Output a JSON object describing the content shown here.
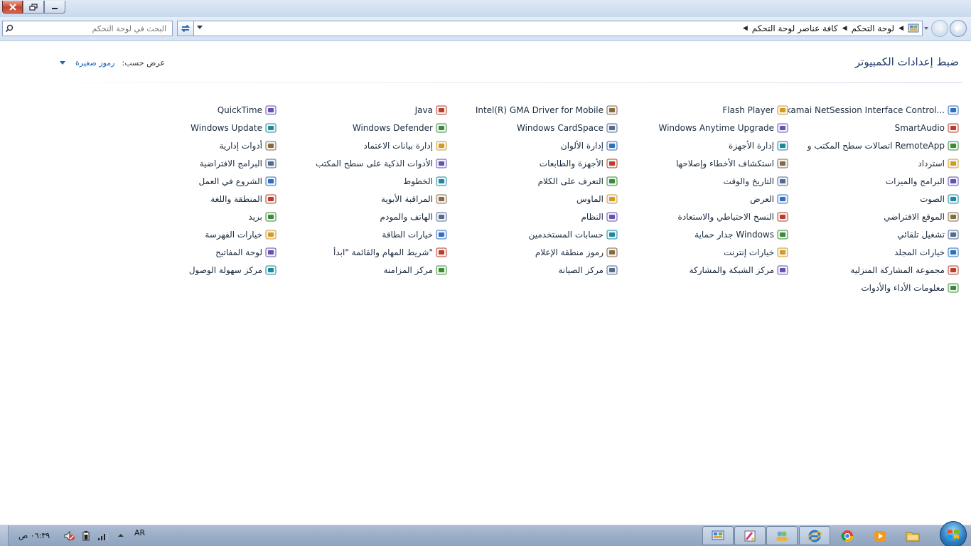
{
  "window": {
    "controls": [
      "close-icon",
      "restore-icon",
      "minimize-icon"
    ]
  },
  "address": {
    "search_placeholder": "البحث في لوحة التحكم",
    "breadcrumbs": [
      "لوحة التحكم",
      "كافة عناصر لوحة التحكم"
    ]
  },
  "header": {
    "title": "ضبط إعدادات الكمبيوتر",
    "view_by_label": "عرض حسب:",
    "view_by_value": "رموز صغيرة"
  },
  "columns": [
    {
      "items": [
        {
          "label": "Akamai NetSession Interface Control...",
          "icon": "akamai-icon"
        },
        {
          "label": "SmartAudio",
          "icon": "smartaudio-icon"
        },
        {
          "label": "اتصالات سطح المكتب و RemoteApp",
          "icon": "remoteapp-icon"
        },
        {
          "label": "استرداد",
          "icon": "recovery-icon"
        },
        {
          "label": "البرامج والميزات",
          "icon": "programs-features-icon"
        },
        {
          "label": "الصوت",
          "icon": "speaker-icon"
        },
        {
          "label": "الموقع الافتراضي",
          "icon": "default-location-icon"
        },
        {
          "label": "تشغيل تلقائي",
          "icon": "autoplay-icon"
        },
        {
          "label": "خيارات المجلد",
          "icon": "folder-options-icon"
        },
        {
          "label": "مجموعة المشاركة المنزلية",
          "icon": "homegroup-icon"
        },
        {
          "label": "معلومات الأداء والأدوات",
          "icon": "performance-icon"
        }
      ]
    },
    {
      "items": [
        {
          "label": "Flash Player",
          "icon": "flash-icon"
        },
        {
          "label": "Windows Anytime Upgrade",
          "icon": "windows-flag-icon"
        },
        {
          "label": "إدارة الأجهزة",
          "icon": "device-manager-icon"
        },
        {
          "label": "استكشاف الأخطاء وإصلاحها",
          "icon": "troubleshoot-icon"
        },
        {
          "label": "التاريخ والوقت",
          "icon": "clock-icon"
        },
        {
          "label": "العرض",
          "icon": "display-icon"
        },
        {
          "label": "النسخ الاحتياطي والاستعادة",
          "icon": "backup-icon"
        },
        {
          "label": "جدار حماية Windows",
          "icon": "firewall-icon"
        },
        {
          "label": "خيارات إنترنت",
          "icon": "internet-options-icon"
        },
        {
          "label": "مركز الشبكة والمشاركة",
          "icon": "network-icon"
        }
      ]
    },
    {
      "items": [
        {
          "label": "Intel(R) GMA Driver for Mobile",
          "icon": "intel-icon"
        },
        {
          "label": "Windows CardSpace",
          "icon": "cardspace-icon"
        },
        {
          "label": "إدارة الألوان",
          "icon": "color-management-icon"
        },
        {
          "label": "الأجهزة والطابعات",
          "icon": "printer-icon"
        },
        {
          "label": "التعرف على الكلام",
          "icon": "microphone-icon"
        },
        {
          "label": "الماوس",
          "icon": "mouse-icon"
        },
        {
          "label": "النظام",
          "icon": "system-icon"
        },
        {
          "label": "حسابات المستخدمين",
          "icon": "users-icon"
        },
        {
          "label": "رموز منطقة الإعلام",
          "icon": "notification-icon"
        },
        {
          "label": "مركز الصيانة",
          "icon": "action-center-flag-icon"
        }
      ]
    },
    {
      "items": [
        {
          "label": "Java",
          "icon": "java-icon"
        },
        {
          "label": "Windows Defender",
          "icon": "defender-icon"
        },
        {
          "label": "إدارة بيانات الاعتماد",
          "icon": "credential-icon"
        },
        {
          "label": "الأدوات الذكية على سطح المكتب",
          "icon": "gadgets-icon"
        },
        {
          "label": "الخطوط",
          "icon": "fonts-icon"
        },
        {
          "label": "المراقبة الأبوية",
          "icon": "parental-icon"
        },
        {
          "label": "الهاتف والمودم",
          "icon": "phone-modem-icon"
        },
        {
          "label": "خيارات الطاقة",
          "icon": "power-icon"
        },
        {
          "label": "شريط المهام والقائمة \"ابدأ\"",
          "icon": "taskbar-icon"
        },
        {
          "label": "مركز المزامنة",
          "icon": "sync-icon"
        }
      ]
    },
    {
      "items": [
        {
          "label": "QuickTime",
          "icon": "quicktime-icon"
        },
        {
          "label": "Windows Update",
          "icon": "windows-update-icon"
        },
        {
          "label": "أدوات إدارية",
          "icon": "admin-tools-icon"
        },
        {
          "label": "البرامج الافتراضية",
          "icon": "default-programs-icon"
        },
        {
          "label": "الشروع في العمل",
          "icon": "getting-started-icon"
        },
        {
          "label": "المنطقة واللغة",
          "icon": "globe-icon"
        },
        {
          "label": "بريد",
          "icon": "mail-icon"
        },
        {
          "label": "خيارات الفهرسة",
          "icon": "indexing-icon"
        },
        {
          "label": "لوحة المفاتيح",
          "icon": "keyboard-icon"
        },
        {
          "label": "مركز سهولة الوصول",
          "icon": "ease-access-icon"
        }
      ]
    }
  ],
  "taskbar": {
    "buttons": [
      "control-panel-icon",
      "paint-icon",
      "users-taskbar-icon",
      "internet-explorer-icon",
      "chrome-icon",
      "media-player-icon",
      "explorer-icon"
    ],
    "tray": {
      "lang": "AR",
      "time": "٠٦:٣٩ ص"
    }
  },
  "colors": {
    "link": "#1d62b4",
    "title": "#1e3a68",
    "close": "#c7432a"
  }
}
